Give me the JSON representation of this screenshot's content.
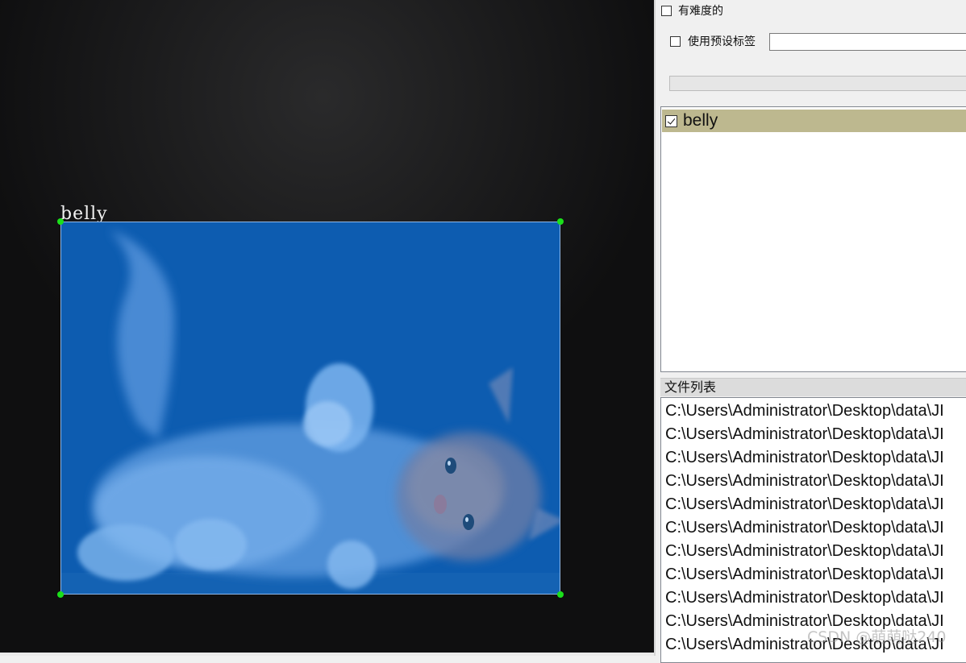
{
  "canvas": {
    "box_label": "belly",
    "box_color": "#0d5cb0",
    "handle_color": "#1be01b"
  },
  "panel": {
    "difficult_label": "有难度的",
    "difficult_checked": false,
    "use_preset_label": "使用预设标签",
    "use_preset_checked": false,
    "preset_input_value": "",
    "labels": [
      {
        "text": "belly",
        "checked": true,
        "highlight": "#bdb88f"
      }
    ],
    "file_list_header": "文件列表",
    "files": [
      "C:\\Users\\Administrator\\Desktop\\data\\JI",
      "C:\\Users\\Administrator\\Desktop\\data\\JI",
      "C:\\Users\\Administrator\\Desktop\\data\\JI",
      "C:\\Users\\Administrator\\Desktop\\data\\JI",
      "C:\\Users\\Administrator\\Desktop\\data\\JI",
      "C:\\Users\\Administrator\\Desktop\\data\\JI",
      "C:\\Users\\Administrator\\Desktop\\data\\JI",
      "C:\\Users\\Administrator\\Desktop\\data\\JI",
      "C:\\Users\\Administrator\\Desktop\\data\\JI",
      "C:\\Users\\Administrator\\Desktop\\data\\JI",
      "C:\\Users\\Administrator\\Desktop\\data\\JI"
    ]
  },
  "watermark": "CSDN @萌萌哒240"
}
